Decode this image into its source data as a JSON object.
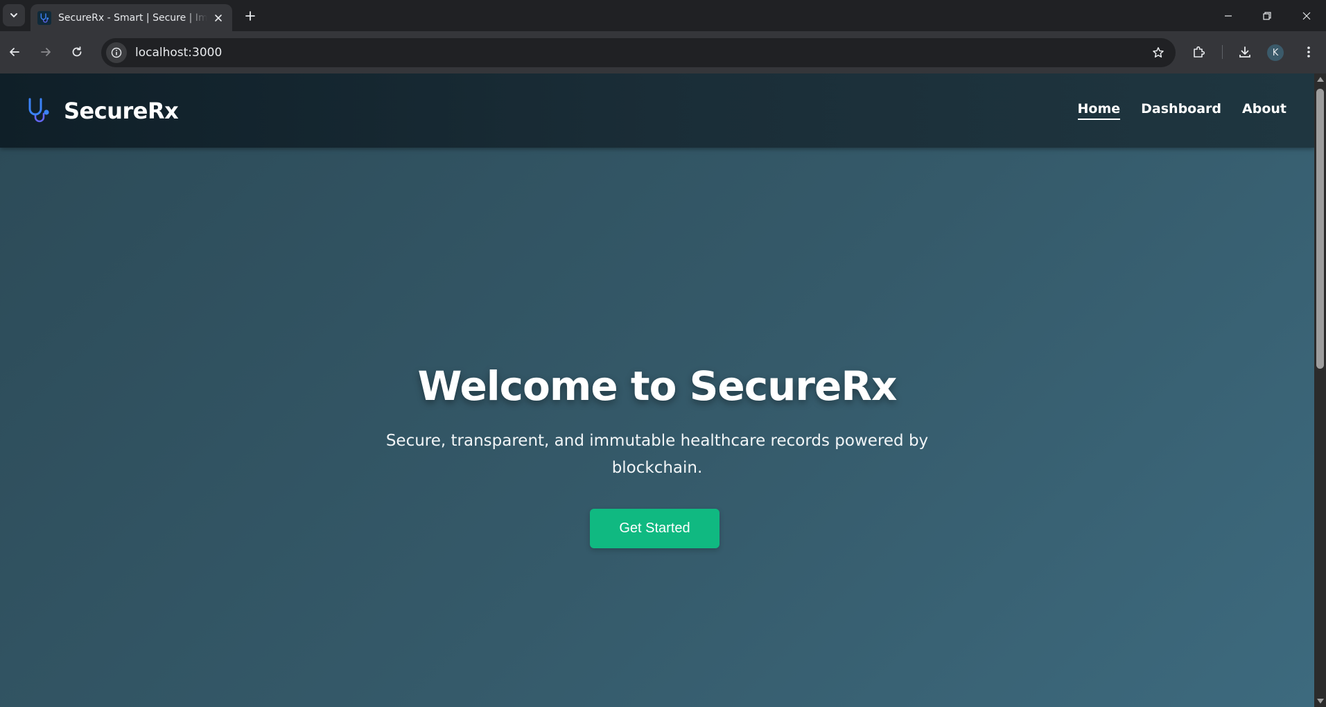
{
  "browser": {
    "tab_title": "SecureRx - Smart | Secure | Immutable",
    "url": "localhost:3000",
    "profile_initial": "K"
  },
  "site": {
    "brand": "SecureRx",
    "nav": [
      {
        "label": "Home",
        "active": true
      },
      {
        "label": "Dashboard",
        "active": false
      },
      {
        "label": "About",
        "active": false
      }
    ]
  },
  "hero": {
    "title": "Welcome to SecureRx",
    "subtitle": "Secure, transparent, and immutable healthcare records powered by blockchain.",
    "cta_label": "Get Started"
  },
  "colors": {
    "accent": "#10b981",
    "brand_icon": "#3b82f6",
    "header_bg": "#0f1f28",
    "hero_bg": "#355a6a"
  },
  "icons": {
    "brand": "stethoscope-icon"
  }
}
